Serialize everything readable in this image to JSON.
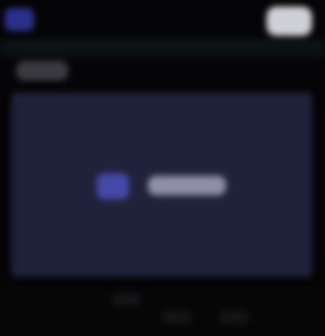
{
  "header": {
    "app_title": "",
    "logo_icon": "app-logo-icon",
    "user_icon": "user-avatar-icon"
  },
  "toolbar": {
    "tab_label": ""
  },
  "main": {
    "panel_icon": "chat-bubble-icon",
    "panel_label": ""
  },
  "colors": {
    "panel_background": "#20223b",
    "accent": "#4648a8"
  }
}
